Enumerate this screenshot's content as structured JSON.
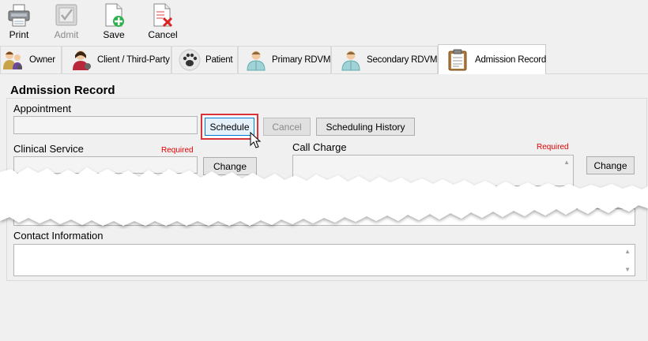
{
  "toolbar": {
    "print_label": "Print",
    "admit_label": "Admit",
    "save_label": "Save",
    "cancel_label": "Cancel"
  },
  "tabs": [
    {
      "label": "Owner"
    },
    {
      "label": "Client / Third-Party"
    },
    {
      "label": "Patient"
    },
    {
      "label": "Primary RDVM"
    },
    {
      "label": "Secondary RDVM"
    },
    {
      "label": "Admission Record"
    }
  ],
  "active_tab": "Admission Record",
  "section": {
    "title": "Admission Record"
  },
  "appointment": {
    "label": "Appointment",
    "value": "",
    "schedule_label": "Schedule",
    "cancel_label": "Cancel",
    "history_label": "Scheduling History"
  },
  "clinical_service": {
    "label": "Clinical Service",
    "required": "Required",
    "change_label": "Change"
  },
  "call_charge": {
    "label": "Call Charge",
    "required": "Required",
    "change_label": "Change"
  },
  "contact": {
    "label": "Contact Information"
  },
  "colors": {
    "required": "#e00000",
    "focus_ring": "#d9323a",
    "accent": "#0078d7"
  }
}
